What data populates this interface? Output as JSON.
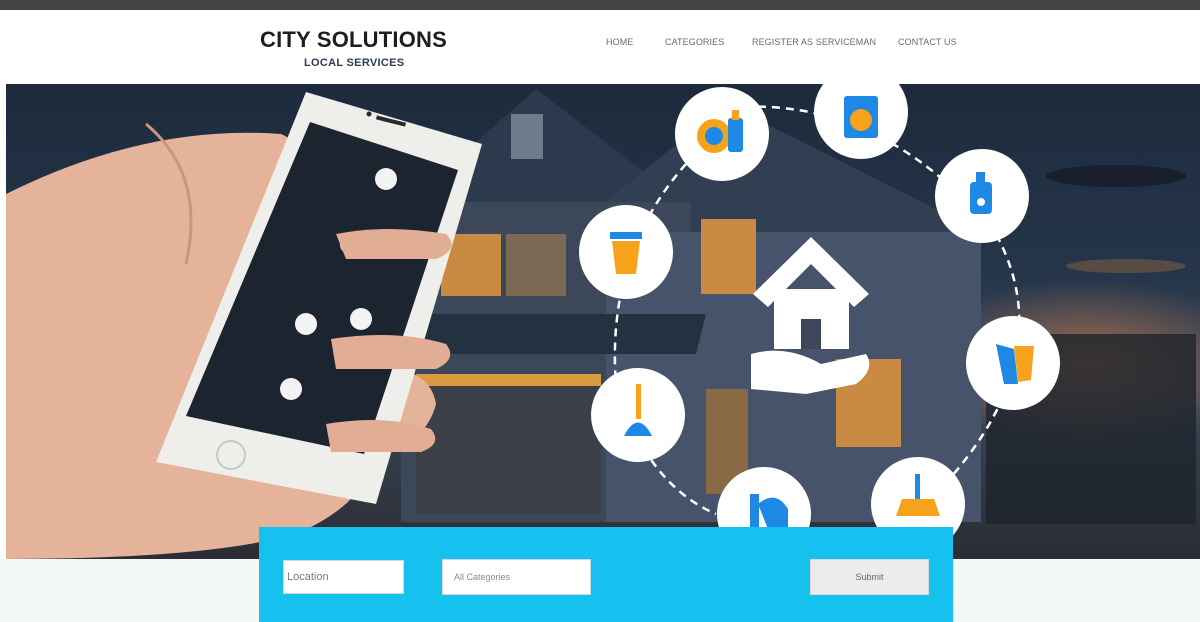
{
  "brand": {
    "title": "CITY SOLUTIONS",
    "subtitle": "LOCAL SERVICES"
  },
  "nav": {
    "items": [
      "HOME",
      "CATEGORIES",
      "REGISTER AS SERVICEMAN",
      "CONTACT US"
    ]
  },
  "search": {
    "location_placeholder": "Location",
    "category_value": "All Categories",
    "submit_label": "Submit"
  },
  "hero": {
    "service_icons": [
      "dishwashing-icon",
      "washing-machine-icon",
      "detergent-icon",
      "trash-bin-icon",
      "gloves-icon",
      "plunger-icon",
      "vacuum-icon",
      "broom-icon",
      "home-in-hand-icon"
    ]
  },
  "colors": {
    "accent": "#16c1f0",
    "icon_blue": "#1e88e5",
    "icon_orange": "#f7a21b",
    "top_bar": "#444444"
  }
}
